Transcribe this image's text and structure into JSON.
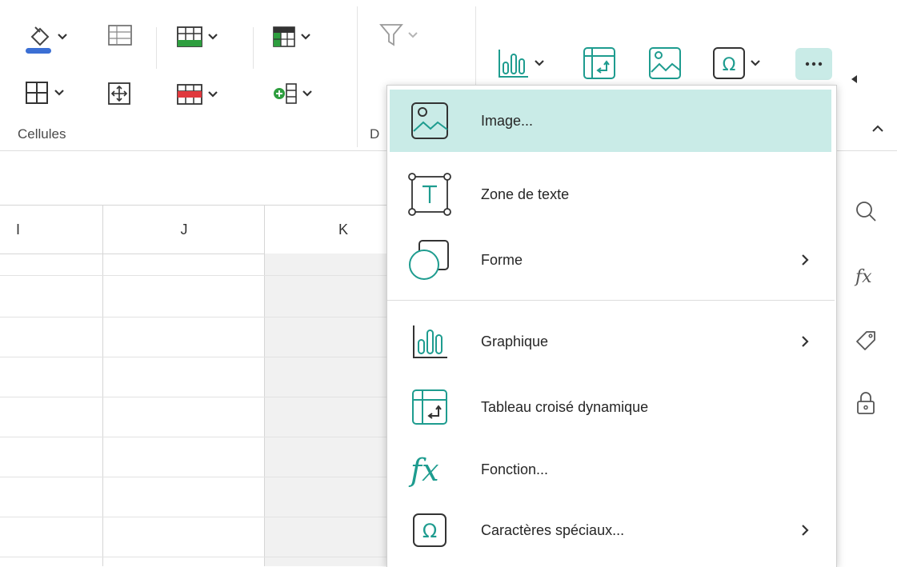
{
  "ribbon": {
    "group_cells_label": "Cellules",
    "group_data_label_partial": "D",
    "more_button": "more-options",
    "icons": [
      "fill-color-icon",
      "cell-format-icon",
      "borders-icon",
      "merge-cells-icon",
      "insert-rows-icon",
      "delete-rows-icon",
      "table-style-icon",
      "insert-column-icon",
      "filter-icon",
      "chart-icon",
      "pivot-table-icon",
      "image-icon",
      "special-char-icon",
      "more-icon",
      "scroll-left-icon",
      "collapse-ribbon-icon"
    ],
    "colors": {
      "accent": "#2aa198",
      "teal": "#20a89a",
      "blue_bar": "#3b6fd4",
      "green": "#2e9e3f",
      "red": "#e0393e"
    }
  },
  "sheet": {
    "columns": [
      "I",
      "J",
      "K"
    ]
  },
  "right_panel": {
    "icons": [
      "search-icon",
      "function-icon",
      "tag-icon",
      "lock-icon"
    ]
  },
  "menu": {
    "items": [
      {
        "label": "Image...",
        "icon": "image-icon",
        "submenu": false,
        "active": true
      },
      {
        "label": "Zone de texte",
        "icon": "text-box-icon",
        "submenu": false,
        "active": false
      },
      {
        "label": "Forme",
        "icon": "shape-icon",
        "submenu": true,
        "active": false
      },
      {
        "label": "Graphique",
        "icon": "chart-icon",
        "submenu": true,
        "active": false
      },
      {
        "label": "Tableau croisé dynamique",
        "icon": "pivot-table-icon",
        "submenu": false,
        "active": false
      },
      {
        "label": "Fonction...",
        "icon": "function-icon",
        "submenu": false,
        "active": false
      },
      {
        "label": "Caractères spéciaux...",
        "icon": "special-char-icon",
        "submenu": true,
        "active": false
      }
    ],
    "active_color": "#c9ebe7",
    "icon_color": "#20a89a"
  }
}
